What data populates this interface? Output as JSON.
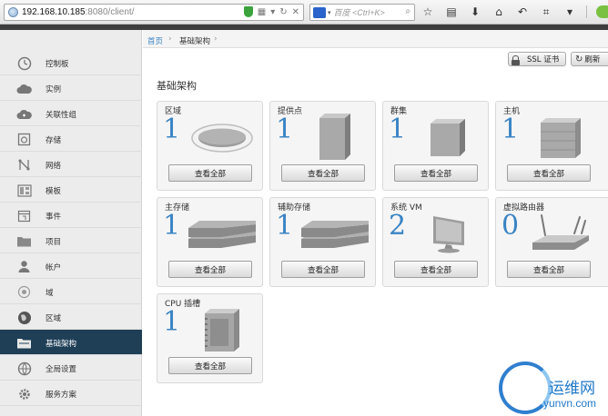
{
  "browser": {
    "url_host": "192.168.10.185",
    "url_path": ":8080/client/",
    "search_placeholder": "百度 <Ctrl+K>"
  },
  "breadcrumb": {
    "home": "首页",
    "current": "基础架构"
  },
  "actions": {
    "ssl_label": "SSL 证书",
    "refresh_label": "刷新"
  },
  "page_title": "基础架构",
  "sidebar": {
    "items": [
      {
        "label": "控制板",
        "icon": "dashboard-icon"
      },
      {
        "label": "实例",
        "icon": "cloud-icon"
      },
      {
        "label": "关联性组",
        "icon": "cloud-group-icon"
      },
      {
        "label": "存储",
        "icon": "storage-icon"
      },
      {
        "label": "网络",
        "icon": "network-icon"
      },
      {
        "label": "模板",
        "icon": "template-icon"
      },
      {
        "label": "事件",
        "icon": "calendar-icon"
      },
      {
        "label": "项目",
        "icon": "folder-icon"
      },
      {
        "label": "帐户",
        "icon": "user-icon"
      },
      {
        "label": "域",
        "icon": "domain-icon"
      },
      {
        "label": "区域",
        "icon": "globe-icon"
      },
      {
        "label": "基础架构",
        "icon": "infrastructure-icon"
      },
      {
        "label": "全局设置",
        "icon": "global-settings-icon"
      },
      {
        "label": "服务方案",
        "icon": "gear-icon"
      }
    ]
  },
  "cards": [
    {
      "title": "区域",
      "count": "1",
      "button": "查看全部",
      "icon": "zone-icon"
    },
    {
      "title": "提供点",
      "count": "1",
      "button": "查看全部",
      "icon": "pod-icon"
    },
    {
      "title": "群集",
      "count": "1",
      "button": "查看全部",
      "icon": "cluster-icon"
    },
    {
      "title": "主机",
      "count": "1",
      "button": "查看全部",
      "icon": "host-icon"
    },
    {
      "title": "主存储",
      "count": "1",
      "button": "查看全部",
      "icon": "primary-storage-icon"
    },
    {
      "title": "辅助存储",
      "count": "1",
      "button": "查看全部",
      "icon": "secondary-storage-icon"
    },
    {
      "title": "系统 VM",
      "count": "2",
      "button": "查看全部",
      "icon": "monitor-icon"
    },
    {
      "title": "虚拟路由器",
      "count": "0",
      "button": "查看全部",
      "icon": "router-icon"
    },
    {
      "title": "CPU 插槽",
      "count": "1",
      "button": "查看全部",
      "icon": "cpu-icon"
    }
  ],
  "watermark": {
    "name": "运维网",
    "url": "yunvn.com"
  }
}
